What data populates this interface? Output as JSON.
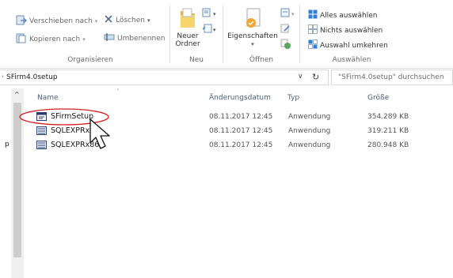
{
  "ribbon": {
    "organize": {
      "label": "Organisieren",
      "move_to": "Verschieben nach",
      "copy_to": "Kopieren nach",
      "delete": "Löschen",
      "rename": "Umbenennen"
    },
    "new": {
      "label": "Neu",
      "new_folder_line1": "Neuer",
      "new_folder_line2": "Ordner"
    },
    "open": {
      "label": "Öffnen",
      "properties": "Eigenschaften"
    },
    "select": {
      "label": "Auswählen",
      "select_all": "Alles auswählen",
      "select_none": "Nichts auswählen",
      "invert": "Auswahl umkehren"
    }
  },
  "address": {
    "path": "SFirm4.0setup",
    "search_placeholder": "\"SFirm4.0setup\" durchsuchen"
  },
  "columns": {
    "name": "Name",
    "date": "Änderungsdatum",
    "type": "Typ",
    "size": "Größe"
  },
  "files": [
    {
      "name": "SFirmSetup",
      "date": "08.11.2017 12:45",
      "type": "Anwendung",
      "size": "354.289 KB"
    },
    {
      "name": "SQLEXPRx64",
      "date": "08.11.2017 12:45",
      "type": "Anwendung",
      "size": "319.211 KB"
    },
    {
      "name": "SQLEXPRx86",
      "date": "08.11.2017 12:45",
      "type": "Anwendung",
      "size": "280.948 KB"
    }
  ],
  "leftpane_fragment": "p",
  "colors": {
    "highlight_ellipse": "#d42020",
    "select_icon_blue": "#2f7fd6",
    "header_text": "#4c607a"
  }
}
